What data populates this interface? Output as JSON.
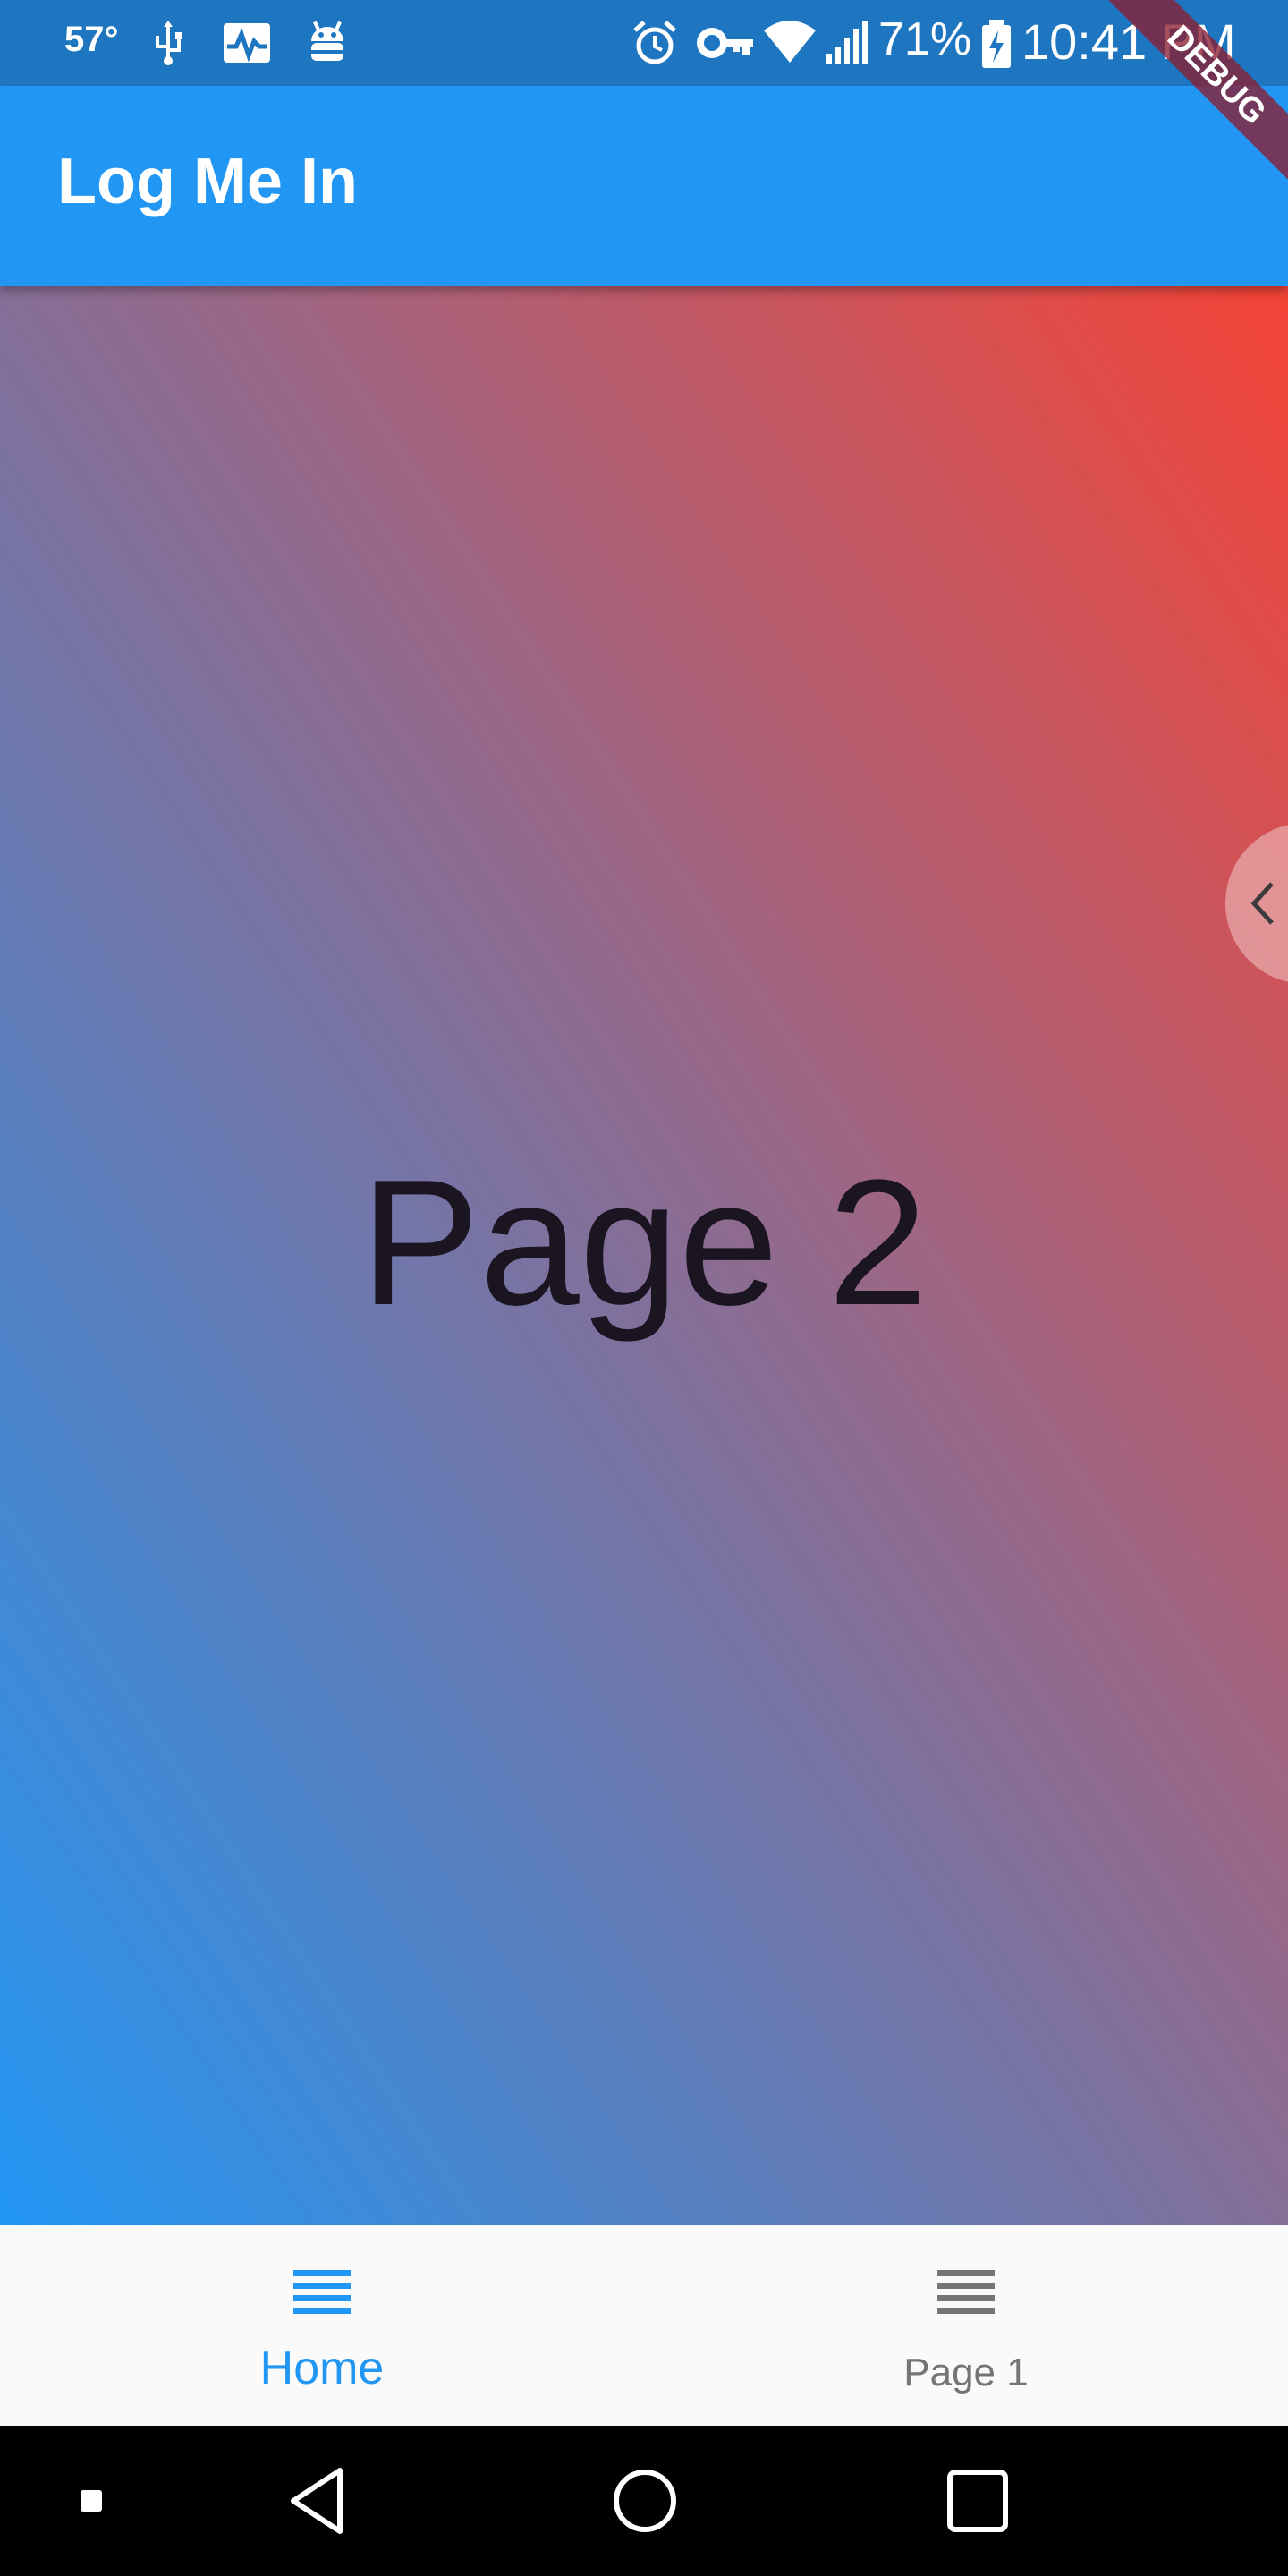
{
  "status_bar": {
    "temperature": "57°",
    "battery": "71%",
    "time": "10:41 PM",
    "icons": [
      "usb-icon",
      "activity-icon",
      "android-debug-icon",
      "alarm-icon",
      "vpn-key-icon",
      "wifi-icon",
      "signal-icon",
      "battery-charging-icon"
    ]
  },
  "debug_banner": "DEBUG",
  "app_bar": {
    "title": "Log Me In"
  },
  "body": {
    "label": "Page 2",
    "gradient": [
      "#2196f3",
      "#f44336"
    ]
  },
  "bottom_nav": {
    "items": [
      {
        "label": "Home",
        "icon": "menu-icon",
        "active": true
      },
      {
        "label": "Page 1",
        "icon": "menu-icon",
        "active": false
      }
    ]
  },
  "system_nav": {
    "buttons": [
      "recents-dot-icon",
      "back-icon",
      "home-icon",
      "overview-icon"
    ]
  },
  "colors": {
    "primary": "#2196f3",
    "status_bar": "#1f76c0",
    "accent_red": "#f44336",
    "inactive": "#757575"
  }
}
